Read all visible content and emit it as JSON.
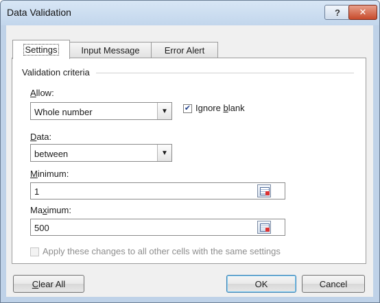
{
  "window": {
    "title": "Data Validation"
  },
  "titlebar": {
    "help_label": "?",
    "close_label": "✕"
  },
  "tabs": [
    {
      "label": "Settings",
      "active": true
    },
    {
      "label": "Input Message",
      "active": false
    },
    {
      "label": "Error Alert",
      "active": false
    }
  ],
  "criteria": {
    "group_label": "Validation criteria",
    "allow": {
      "key": "A",
      "rest": "llow:",
      "value": "Whole number"
    },
    "ignore_blank": {
      "label_pre": "Ignore ",
      "key": "b",
      "label_post": "lank",
      "checked": true,
      "check_glyph": "✔"
    },
    "data": {
      "key": "D",
      "rest": "ata:",
      "value": "between"
    },
    "minimum": {
      "key": "M",
      "rest": "inimum:",
      "value": "1"
    },
    "maximum": {
      "pre": "Ma",
      "key": "x",
      "rest": "imum:",
      "value": "500"
    }
  },
  "apply_all": {
    "label": "Apply these changes to all other cells with the same settings",
    "checked": false,
    "enabled": false
  },
  "buttons": {
    "clear_all_key": "C",
    "clear_all_rest": "lear All",
    "ok": "OK",
    "cancel": "Cancel"
  }
}
